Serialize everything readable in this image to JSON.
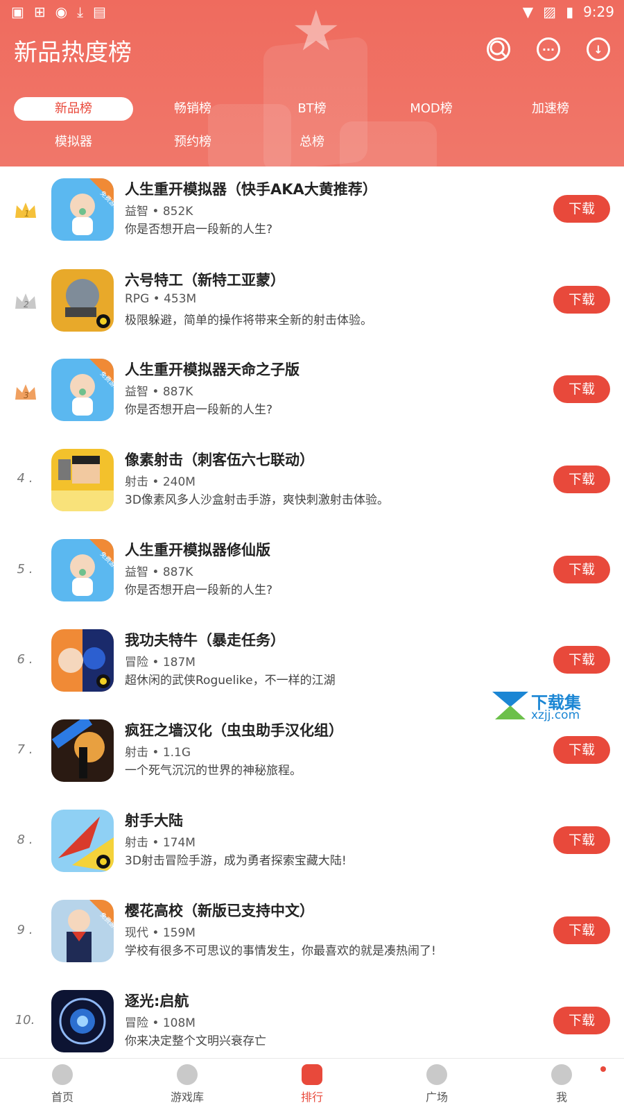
{
  "status_bar": {
    "time": "9:29"
  },
  "header": {
    "title": "新品热度榜",
    "icons": [
      "search-icon",
      "message-icon",
      "download-icon"
    ]
  },
  "tabs": [
    "新品榜",
    "畅销榜",
    "BT榜",
    "MOD榜",
    "加速榜",
    "模拟器",
    "预约榜",
    "总榜"
  ],
  "active_tab": "新品榜",
  "apps": [
    {
      "rank": "1",
      "name": "人生重开模拟器（快手AKA大黄推荐）",
      "meta": "益智 • 852K",
      "desc": "你是否想开启一段新的人生?",
      "badge": "免费游戏",
      "button": "下载"
    },
    {
      "rank": "2",
      "name": "六号特工（新特工亚蒙）",
      "meta": "RPG • 453M",
      "desc": "极限躲避，简单的操作将带来全新的射击体验。",
      "badge": "",
      "button": "下载"
    },
    {
      "rank": "3",
      "name": "人生重开模拟器天命之子版",
      "meta": "益智 • 887K",
      "desc": "你是否想开启一段新的人生?",
      "badge": "免费游戏",
      "button": "下载"
    },
    {
      "rank": "4 .",
      "name": "像素射击（刺客伍六七联动）",
      "meta": "射击 • 240M",
      "desc": "3D像素风多人沙盒射击手游，爽快刺激射击体验。",
      "badge": "",
      "button": "下载"
    },
    {
      "rank": "5 .",
      "name": "人生重开模拟器修仙版",
      "meta": "益智 • 887K",
      "desc": "你是否想开启一段新的人生?",
      "badge": "免费游戏",
      "button": "下载"
    },
    {
      "rank": "6 .",
      "name": "我功夫特牛（暴走任务）",
      "meta": "冒险 • 187M",
      "desc": "超休闲的武侠Roguelike，不一样的江湖",
      "badge": "",
      "button": "下载"
    },
    {
      "rank": "7 .",
      "name": "疯狂之墙汉化（虫虫助手汉化组）",
      "meta": "射击 • 1.1G",
      "desc": "一个死气沉沉的世界的神秘旅程。",
      "badge": "",
      "button": "下载"
    },
    {
      "rank": "8 .",
      "name": "射手大陆",
      "meta": "射击 • 174M",
      "desc": "3D射击冒险手游，成为勇者探索宝藏大陆!",
      "badge": "",
      "button": "下载"
    },
    {
      "rank": "9 .",
      "name": "樱花高校（新版已支持中文）",
      "meta": "现代 • 159M",
      "desc": "学校有很多不可思议的事情发生，你最喜欢的就是凑热闹了!",
      "badge": "免费游戏",
      "button": "下载"
    },
    {
      "rank": "10.",
      "name": "逐光:启航",
      "meta": "冒险 • 108M",
      "desc": "你来决定整个文明兴衰存亡",
      "badge": "",
      "button": "下载"
    }
  ],
  "watermark": {
    "text": "下载集",
    "sub": "xzjj.com"
  },
  "bottom_nav": [
    {
      "label": "首页",
      "icon": "home-icon"
    },
    {
      "label": "游戏库",
      "icon": "gamepad-icon"
    },
    {
      "label": "排行",
      "icon": "trophy-icon"
    },
    {
      "label": "广场",
      "icon": "square-icon"
    },
    {
      "label": "我",
      "icon": "user-icon"
    }
  ],
  "active_nav": "排行",
  "colors": {
    "brand": "#e8493b",
    "header_bg": "#ef6b5e",
    "gold": "#f5c13a",
    "silver": "#c8c8c8",
    "bronze": "#f0a060"
  }
}
